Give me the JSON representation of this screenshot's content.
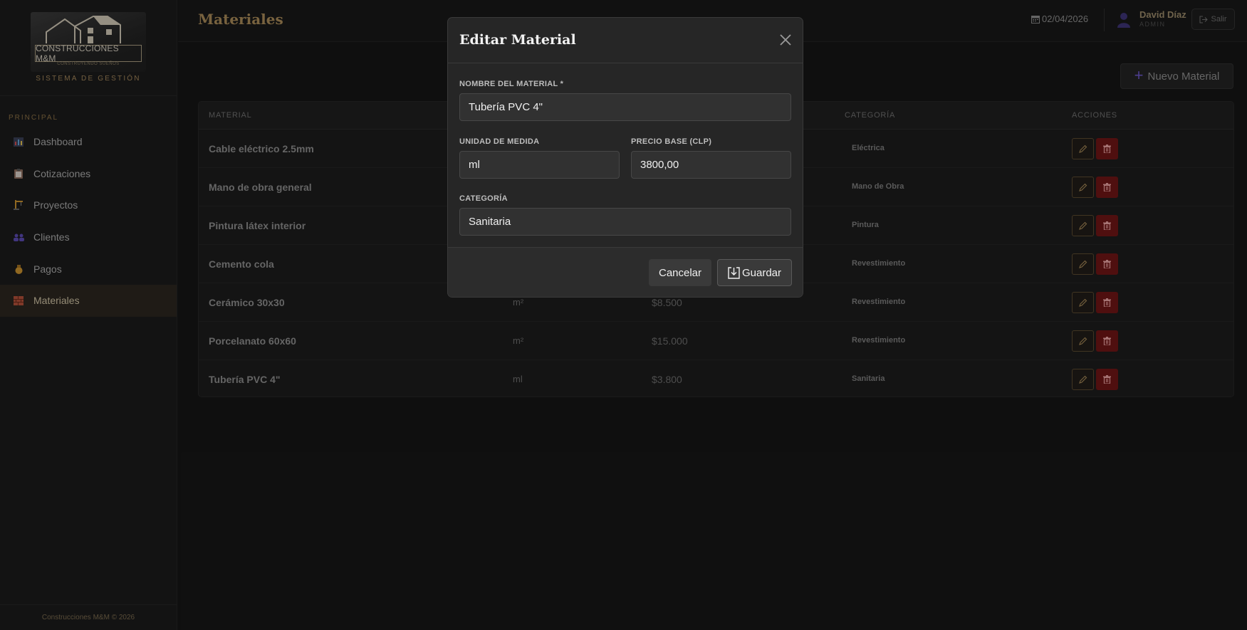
{
  "app": {
    "brand": "CONSTRUCCIONES M&M",
    "tagline": "CONSTRUYENDO SUEÑOS",
    "system_label": "SISTEMA DE GESTIÓN",
    "footer": "Construcciones M&M © 2026"
  },
  "sidebar": {
    "section": "PRINCIPAL",
    "items": [
      {
        "label": "Dashboard",
        "icon": "bar-chart-icon",
        "active": false
      },
      {
        "label": "Cotizaciones",
        "icon": "clipboard-icon",
        "active": false
      },
      {
        "label": "Proyectos",
        "icon": "crane-icon",
        "active": false
      },
      {
        "label": "Clientes",
        "icon": "users-icon",
        "active": false
      },
      {
        "label": "Pagos",
        "icon": "money-bag-icon",
        "active": false
      },
      {
        "label": "Materiales",
        "icon": "bricks-icon",
        "active": true
      }
    ]
  },
  "header": {
    "title": "Materiales",
    "date": "02/04/2026",
    "user_name": "David Díaz",
    "user_role": "ADMIN",
    "logout": "Salir"
  },
  "toolbar": {
    "new_material": "Nuevo Material"
  },
  "table": {
    "headers": {
      "material": "MATERIAL",
      "category": "CATEGORÍA",
      "actions": "ACCIONES"
    },
    "rows": [
      {
        "name": "Cable eléctrico 2.5mm",
        "unit": "",
        "price": "",
        "category": "Eléctrica"
      },
      {
        "name": "Mano de obra general",
        "unit": "",
        "price": "",
        "category": "Mano de Obra"
      },
      {
        "name": "Pintura látex interior",
        "unit": "",
        "price": "",
        "category": "Pintura"
      },
      {
        "name": "Cemento cola",
        "unit": "",
        "price": "",
        "category": "Revestimiento"
      },
      {
        "name": "Cerámico 30x30",
        "unit": "m²",
        "price": "$8.500",
        "category": "Revestimiento"
      },
      {
        "name": "Porcelanato 60x60",
        "unit": "m²",
        "price": "$15.000",
        "category": "Revestimiento"
      },
      {
        "name": "Tubería PVC 4\"",
        "unit": "ml",
        "price": "$3.800",
        "category": "Sanitaria"
      }
    ]
  },
  "modal": {
    "title": "Editar Material",
    "name_label": "NOMBRE DEL MATERIAL *",
    "name_value": "Tubería PVC 4\"",
    "unit_label": "UNIDAD DE MEDIDA",
    "unit_value": "ml",
    "price_label": "PRECIO BASE (CLP)",
    "price_value": "3800,00",
    "category_label": "CATEGORÍA",
    "category_value": "Sanitaria",
    "cancel": "Cancelar",
    "save": "Guardar"
  },
  "colors": {
    "accent_gold": "#a88a58",
    "delete_red": "#6e1616",
    "plus_purple": "#6b57c8"
  }
}
